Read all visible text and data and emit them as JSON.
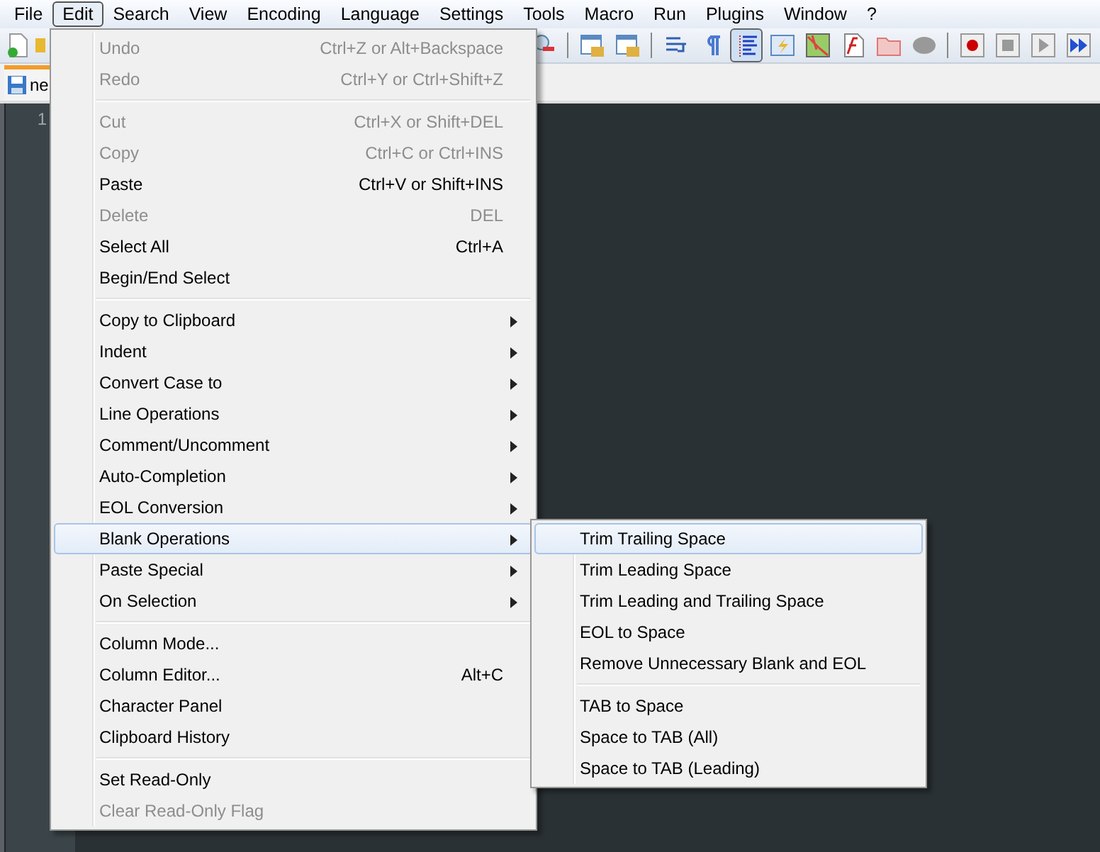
{
  "menu_bar": [
    {
      "label": "File",
      "selected": false
    },
    {
      "label": "Edit",
      "selected": true
    },
    {
      "label": "Search",
      "selected": false
    },
    {
      "label": "View",
      "selected": false
    },
    {
      "label": "Encoding",
      "selected": false
    },
    {
      "label": "Language",
      "selected": false
    },
    {
      "label": "Settings",
      "selected": false
    },
    {
      "label": "Tools",
      "selected": false
    },
    {
      "label": "Macro",
      "selected": false
    },
    {
      "label": "Run",
      "selected": false
    },
    {
      "label": "Plugins",
      "selected": false
    },
    {
      "label": "Window",
      "selected": false
    },
    {
      "label": "?",
      "selected": false
    }
  ],
  "tab": {
    "label": "ne"
  },
  "editor": {
    "line_number": "1"
  },
  "edit_menu": [
    {
      "kind": "item",
      "label": "Undo",
      "shortcut": "Ctrl+Z or Alt+Backspace",
      "disabled": true,
      "submenu": false,
      "selected": false
    },
    {
      "kind": "item",
      "label": "Redo",
      "shortcut": "Ctrl+Y or Ctrl+Shift+Z",
      "disabled": true,
      "submenu": false,
      "selected": false
    },
    {
      "kind": "separator"
    },
    {
      "kind": "item",
      "label": "Cut",
      "shortcut": "Ctrl+X or Shift+DEL",
      "disabled": true,
      "submenu": false,
      "selected": false
    },
    {
      "kind": "item",
      "label": "Copy",
      "shortcut": "Ctrl+C or Ctrl+INS",
      "disabled": true,
      "submenu": false,
      "selected": false
    },
    {
      "kind": "item",
      "label": "Paste",
      "shortcut": "Ctrl+V or Shift+INS",
      "disabled": false,
      "submenu": false,
      "selected": false
    },
    {
      "kind": "item",
      "label": "Delete",
      "shortcut": "DEL",
      "disabled": true,
      "submenu": false,
      "selected": false
    },
    {
      "kind": "item",
      "label": "Select All",
      "shortcut": "Ctrl+A",
      "disabled": false,
      "submenu": false,
      "selected": false
    },
    {
      "kind": "item",
      "label": "Begin/End Select",
      "disabled": false,
      "submenu": false,
      "selected": false
    },
    {
      "kind": "separator"
    },
    {
      "kind": "item",
      "label": "Copy to Clipboard",
      "disabled": false,
      "submenu": true,
      "selected": false
    },
    {
      "kind": "item",
      "label": "Indent",
      "disabled": false,
      "submenu": true,
      "selected": false
    },
    {
      "kind": "item",
      "label": "Convert Case to",
      "disabled": false,
      "submenu": true,
      "selected": false
    },
    {
      "kind": "item",
      "label": "Line Operations",
      "disabled": false,
      "submenu": true,
      "selected": false
    },
    {
      "kind": "item",
      "label": "Comment/Uncomment",
      "disabled": false,
      "submenu": true,
      "selected": false
    },
    {
      "kind": "item",
      "label": "Auto-Completion",
      "disabled": false,
      "submenu": true,
      "selected": false
    },
    {
      "kind": "item",
      "label": "EOL Conversion",
      "disabled": false,
      "submenu": true,
      "selected": false
    },
    {
      "kind": "item",
      "label": "Blank Operations",
      "disabled": false,
      "submenu": true,
      "selected": true
    },
    {
      "kind": "item",
      "label": "Paste Special",
      "disabled": false,
      "submenu": true,
      "selected": false
    },
    {
      "kind": "item",
      "label": "On Selection",
      "disabled": false,
      "submenu": true,
      "selected": false
    },
    {
      "kind": "separator"
    },
    {
      "kind": "item",
      "label": "Column Mode...",
      "disabled": false,
      "submenu": false,
      "selected": false
    },
    {
      "kind": "item",
      "label": "Column Editor...",
      "shortcut": "Alt+C",
      "disabled": false,
      "submenu": false,
      "selected": false
    },
    {
      "kind": "item",
      "label": "Character Panel",
      "disabled": false,
      "submenu": false,
      "selected": false
    },
    {
      "kind": "item",
      "label": "Clipboard History",
      "disabled": false,
      "submenu": false,
      "selected": false
    },
    {
      "kind": "separator"
    },
    {
      "kind": "item",
      "label": "Set Read-Only",
      "disabled": false,
      "submenu": false,
      "selected": false
    },
    {
      "kind": "item",
      "label": "Clear Read-Only Flag",
      "disabled": true,
      "submenu": false,
      "selected": false
    }
  ],
  "blank_operations_menu": [
    {
      "kind": "item",
      "label": "Trim Trailing Space",
      "selected": true
    },
    {
      "kind": "item",
      "label": "Trim Leading Space",
      "selected": false
    },
    {
      "kind": "item",
      "label": "Trim Leading and Trailing Space",
      "selected": false
    },
    {
      "kind": "item",
      "label": "EOL to Space",
      "selected": false
    },
    {
      "kind": "item",
      "label": "Remove Unnecessary Blank and EOL",
      "selected": false
    },
    {
      "kind": "separator"
    },
    {
      "kind": "item",
      "label": "TAB to Space",
      "selected": false
    },
    {
      "kind": "item",
      "label": "Space to TAB (All)",
      "selected": false
    },
    {
      "kind": "item",
      "label": "Space to TAB (Leading)",
      "selected": false
    }
  ]
}
